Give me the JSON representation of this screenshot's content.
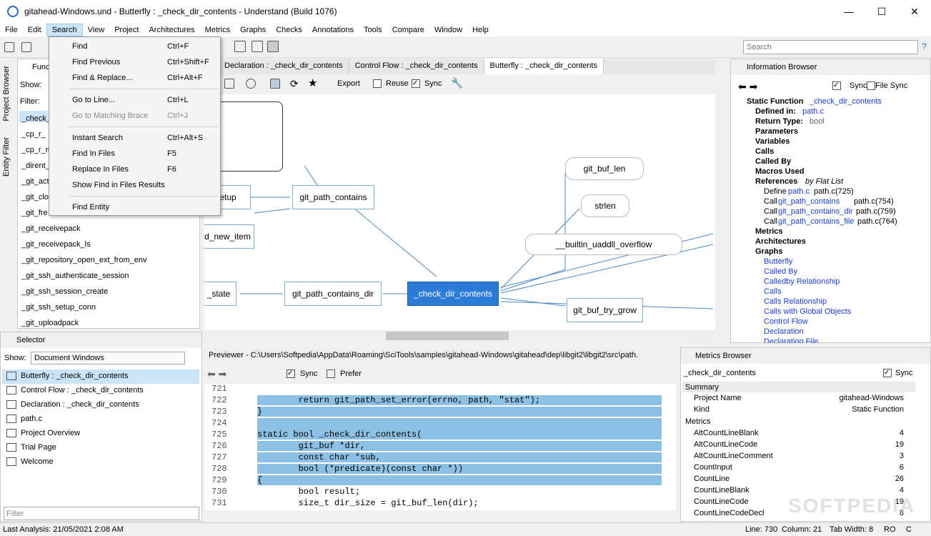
{
  "window": {
    "title": "gitahead-Windows.und - Butterfly : _check_dir_contents - Understand (Build 1076)",
    "buttons": [
      "—",
      "☐",
      "✕"
    ]
  },
  "menu": [
    "File",
    "Edit",
    "Search",
    "View",
    "Project",
    "Architectures",
    "Metrics",
    "Graphs",
    "Checks",
    "Annotations",
    "Tools",
    "Compare",
    "Window",
    "Help"
  ],
  "search": {
    "placeholder": "Search",
    "help": "?"
  },
  "search_menu": [
    {
      "label": "Find",
      "shortcut": "Ctrl+F",
      "disabled": false
    },
    {
      "label": "Find Previous",
      "shortcut": "Ctrl+Shift+F",
      "disabled": false
    },
    {
      "label": "Find & Replace...",
      "shortcut": "Ctrl+Alt+F",
      "disabled": false
    },
    {
      "label": "Go to Line...",
      "shortcut": "Ctrl+L",
      "disabled": false
    },
    {
      "label": "Go to Matching Brace",
      "shortcut": "Ctrl+J",
      "disabled": true
    },
    {
      "label": "Instant Search",
      "shortcut": "Ctrl+Alt+S",
      "disabled": false
    },
    {
      "label": "Find In Files",
      "shortcut": "F5",
      "disabled": false
    },
    {
      "label": "Replace In Files",
      "shortcut": "F6",
      "disabled": false
    },
    {
      "label": "Show Find in Files Results",
      "shortcut": "",
      "disabled": false
    },
    {
      "label": "Find Entity",
      "shortcut": "",
      "disabled": false
    }
  ],
  "vertical_tabs": [
    "Project Browser",
    "Entity Filter"
  ],
  "left_panel": {
    "header": "Func",
    "show_label": "Show:",
    "filter_label": "Filter:",
    "items": [
      "_check_",
      "_cp_r_",
      "_cp_r_m",
      "_dirent_",
      "_git_act",
      "_git_clo",
      "_git_fre",
      "_git_receivepack",
      "_git_receivepack_ls",
      "_git_repository_open_ext_from_env",
      "_git_ssh_authenticate_session",
      "_git_ssh_session_create",
      "_git_ssh_setup_conn",
      "_git_uploadpack"
    ]
  },
  "selector": {
    "title": "Selector",
    "show_label": "Show:",
    "show_value": "Document Windows",
    "filter_placeholder": "Filter",
    "items": [
      "Butterfly : _check_dir_contents",
      "Control Flow : _check_dir_contents",
      "Declaration : _check_dir_contents",
      "path.c",
      "Project Overview",
      "Trial Page",
      "Welcome"
    ]
  },
  "tabs": [
    "Declaration : _check_dir_contents",
    "Control Flow : _check_dir_contents",
    "Butterfly : _check_dir_contents"
  ],
  "graph_toolbar": {
    "export": "Export",
    "reuse": "Reuse",
    "sync": "Sync"
  },
  "graph_nodes": [
    "setup",
    "git_path_contains",
    "d_new_item",
    "_state",
    "git_path_contains_dir",
    "_check_dir_contents",
    "git_buf_len",
    "strlen",
    "__builtin_uaddll_overflow",
    "git_buf_try_grow"
  ],
  "info": {
    "title": "Information Browser",
    "sync": "Sync",
    "file_sync": "File Sync",
    "static_function_label": "Static Function",
    "static_function": "_check_dir_contents",
    "defined_in_label": "Defined in:",
    "defined_in": "path.c",
    "return_type_label": "Return Type:",
    "return_type": "bool",
    "sections": [
      "Parameters",
      "Variables",
      "Calls",
      "Called By",
      "Macros Used"
    ],
    "references_label": "References",
    "references_mode": "by Flat List",
    "refs": [
      {
        "kind": "Define",
        "ent": "path.c",
        "loc": "path.c(725)"
      },
      {
        "kind": "Call",
        "ent": "git_path_contains",
        "loc": "path.c(754)"
      },
      {
        "kind": "Call",
        "ent": "git_path_contains_dir",
        "loc": "path.c(759)"
      },
      {
        "kind": "Call",
        "ent": "git_path_contains_file",
        "loc": "path.c(764)"
      }
    ],
    "sections2": [
      "Metrics",
      "Architectures",
      "Graphs"
    ],
    "graphs": [
      "Butterfly",
      "Called By",
      "Calledby Relationship",
      "Calls",
      "Calls Relationship",
      "Calls with Global Objects",
      "Control Flow",
      "Declaration",
      "Declaration File"
    ]
  },
  "previewer": {
    "title": "Previewer - C:\\Users\\Softpedia\\AppData\\Roaming\\SciTools\\samples\\gitahead-Windows\\gitahead\\dep\\libgit2\\libgit2\\src\\path.",
    "sync": "Sync",
    "prefer": "Prefer"
  },
  "code": [
    {
      "n": "721",
      "t": ""
    },
    {
      "n": "722",
      "t": "        return git_path_set_error(errno, path, \"stat\");"
    },
    {
      "n": "723",
      "t": "}"
    },
    {
      "n": "724",
      "t": ""
    },
    {
      "n": "725",
      "t": "static bool _check_dir_contents("
    },
    {
      "n": "726",
      "t": "        git_buf *dir,"
    },
    {
      "n": "727",
      "t": "        const char *sub,"
    },
    {
      "n": "728",
      "t": "        bool (*predicate)(const char *))"
    },
    {
      "n": "729",
      "t": "{"
    },
    {
      "n": "730",
      "t": "        bool result;"
    },
    {
      "n": "731",
      "t": "        size_t dir_size = git_buf_len(dir);"
    }
  ],
  "metrics_browser": {
    "title": "Metrics Browser",
    "entity": "_check_dir_contents",
    "sync": "Sync",
    "summary_label": "Summary",
    "metrics_label": "Metrics",
    "summary": [
      {
        "k": "Project Name",
        "v": "gitahead-Windows"
      },
      {
        "k": "Kind",
        "v": "Static Function"
      }
    ],
    "rows": [
      {
        "k": "AltCountLineBlank",
        "v": "4"
      },
      {
        "k": "AltCountLineCode",
        "v": "19"
      },
      {
        "k": "AltCountLineComment",
        "v": "3"
      },
      {
        "k": "CountInput",
        "v": "6"
      },
      {
        "k": "CountLine",
        "v": "26"
      },
      {
        "k": "CountLineBlank",
        "v": "4"
      },
      {
        "k": "CountLineCode",
        "v": "19"
      },
      {
        "k": "CountLineCodeDecl",
        "v": "8"
      }
    ]
  },
  "status": {
    "left": "Last Analysis: 21/05/2021 2:08 AM",
    "line": "Line: 730",
    "column": "Column: 21",
    "tab": "Tab Width: 8",
    "ro": "RO",
    "c": "C"
  },
  "watermark": "SOFTPEDIA"
}
